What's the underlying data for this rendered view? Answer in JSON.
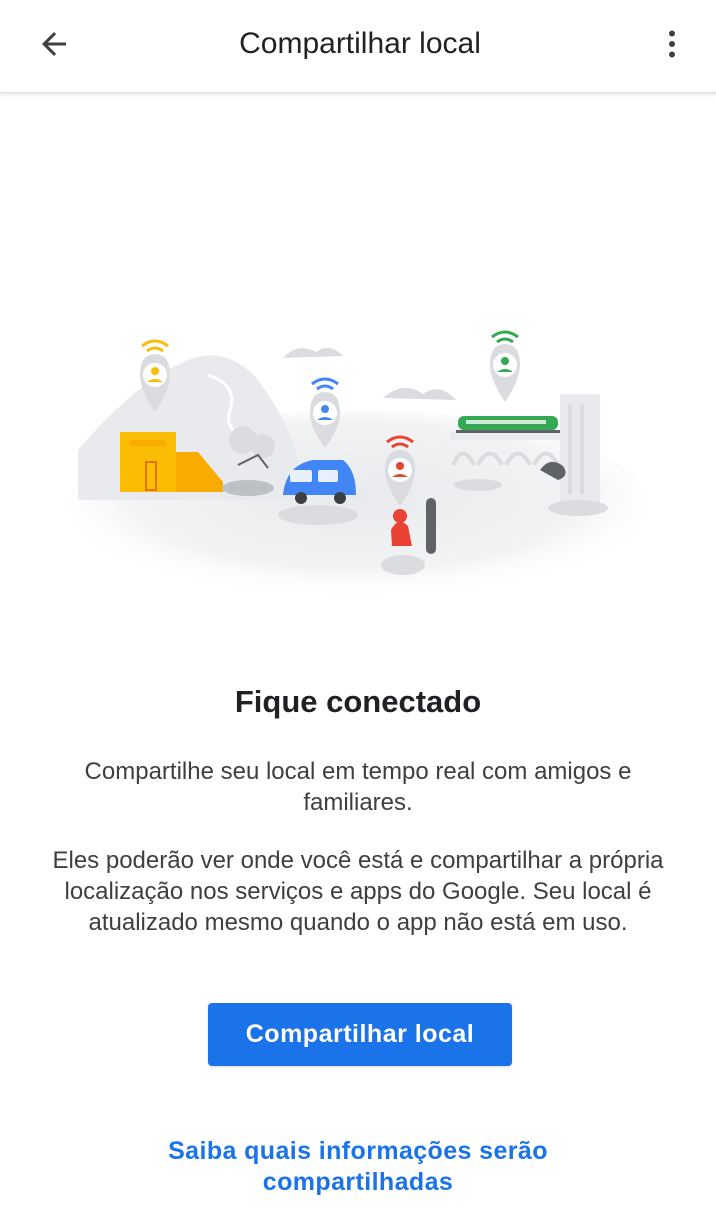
{
  "header": {
    "title": "Compartilhar local",
    "back_icon": "arrow-back-icon",
    "more_icon": "more-vert-icon"
  },
  "hero": {
    "illustration": "location-sharing-city-illustration",
    "pin_colors": {
      "yellow": "#fbbc04",
      "blue": "#4285f4",
      "red": "#ea4335",
      "green": "#34a853"
    }
  },
  "content": {
    "heading": "Fique conectado",
    "paragraph1": "Compartilhe seu local em tempo real com amigos e familiares.",
    "paragraph2": "Eles poderão ver onde você está e compartilhar a própria localização nos serviços e apps do Google. Seu local é atualizado mesmo quando o app não está em uso."
  },
  "actions": {
    "share_button": "Compartilhar local",
    "learn_more_link": "Saiba quais informações serão compartilhadas"
  },
  "colors": {
    "accent": "#1a73e8",
    "text_primary": "#202124",
    "text_secondary": "#3c4043"
  }
}
